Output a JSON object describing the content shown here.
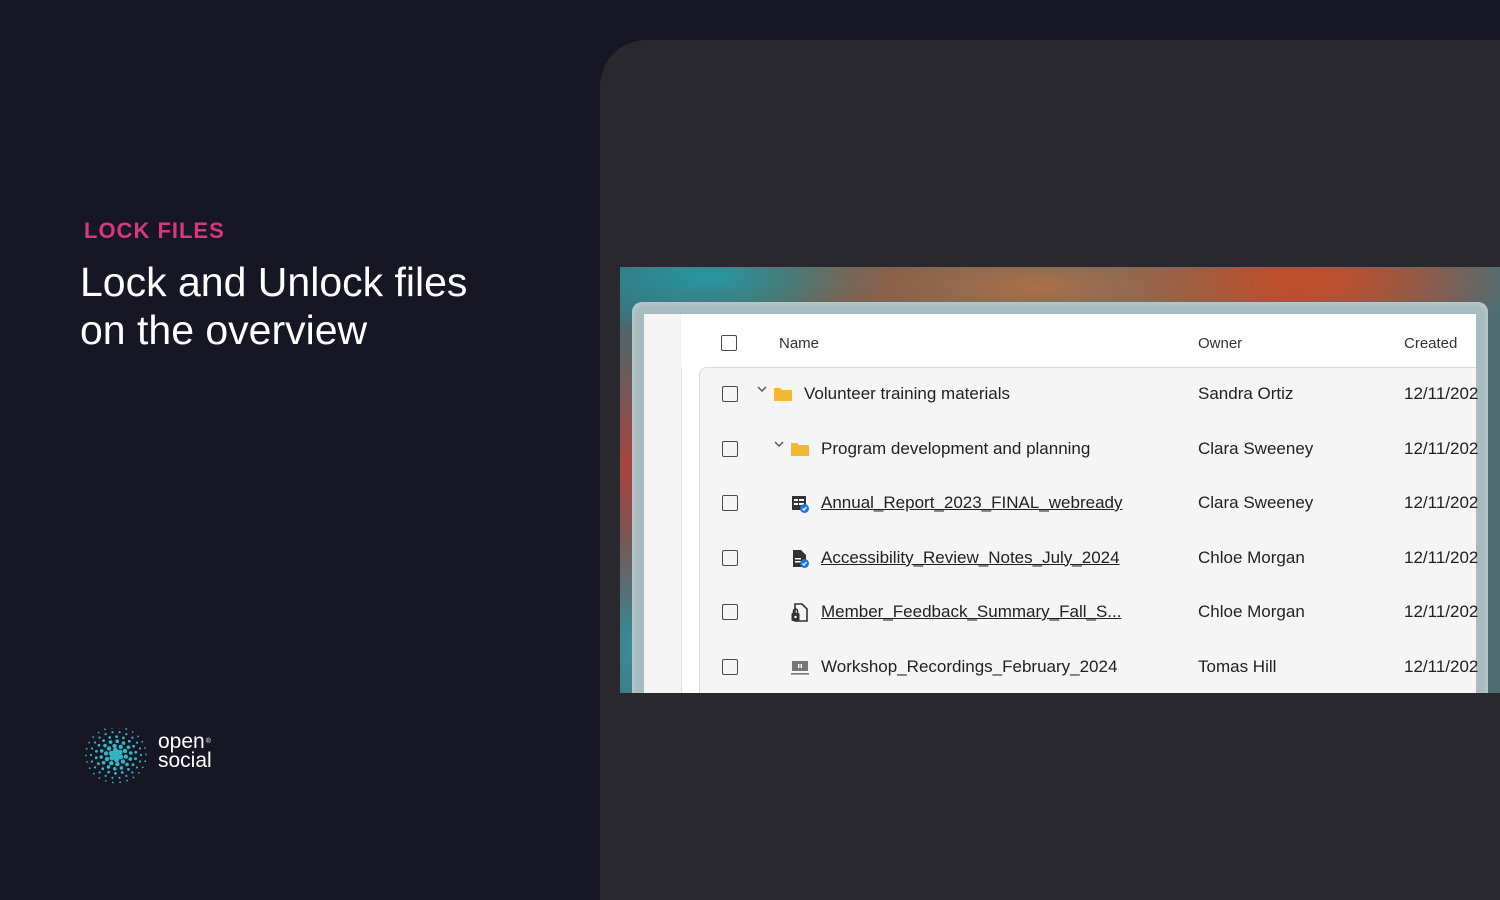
{
  "hero": {
    "eyebrow": "LOCK FILES",
    "title_line1": "Lock and Unlock files",
    "title_line2": "on the overview"
  },
  "brand": {
    "line1": "open",
    "line2": "social",
    "reg": "®",
    "icon": "dot-burst-logo"
  },
  "colors": {
    "accent": "#d6377e",
    "background": "#161624",
    "panel": "#28282e"
  },
  "table": {
    "headers": {
      "name": "Name",
      "owner": "Owner",
      "created": "Created"
    },
    "rows": [
      {
        "name": "Volunteer training materials",
        "owner": "Sandra Ortiz",
        "created": "12/11/202",
        "type": "folder",
        "icon": "folder-icon",
        "expanded": true,
        "link": false
      },
      {
        "name": "Program development and planning",
        "owner": "Clara Sweeney",
        "created": "12/11/202",
        "type": "folder",
        "icon": "folder-icon",
        "expanded": true,
        "link": false
      },
      {
        "name": "Annual_Report_2023_FINAL_webready",
        "owner": "Clara Sweeney",
        "created": "12/11/202",
        "type": "spreadsheet",
        "icon": "spreadsheet-check-icon",
        "link": true
      },
      {
        "name": "Accessibility_Review_Notes_July_2024",
        "owner": "Chloe Morgan",
        "created": "12/11/202",
        "type": "document",
        "icon": "document-check-icon",
        "link": true
      },
      {
        "name": "Member_Feedback_Summary_Fall_S...",
        "owner": "Chloe Morgan",
        "created": "12/11/202",
        "type": "locked-document",
        "icon": "document-lock-icon",
        "link": true
      },
      {
        "name": "Workshop_Recordings_February_2024",
        "owner": "Tomas Hill",
        "created": "12/11/202",
        "type": "presentation",
        "icon": "presentation-icon",
        "link": false
      }
    ]
  }
}
